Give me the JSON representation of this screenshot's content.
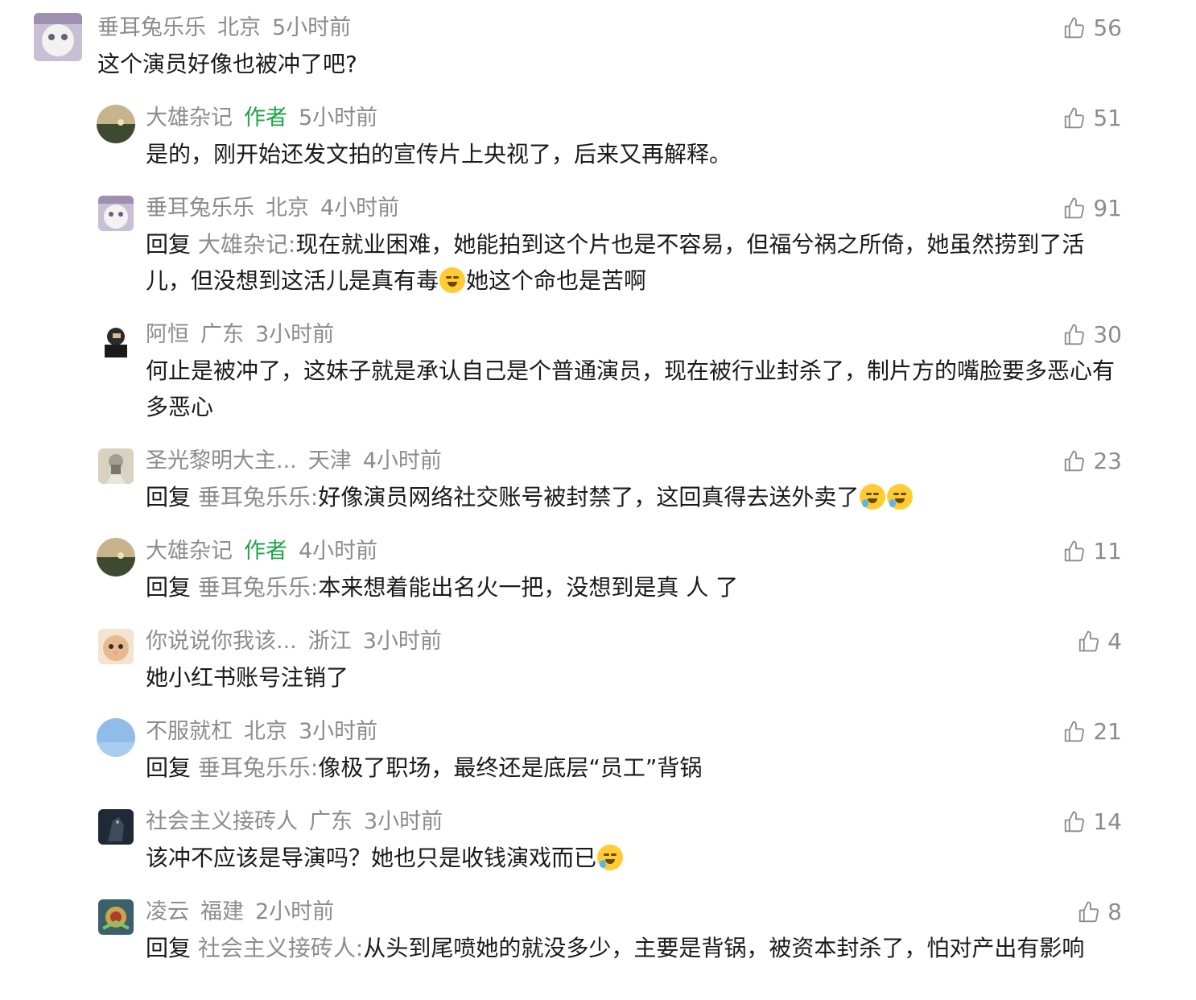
{
  "comments": [
    {
      "username": "垂耳兔乐乐",
      "author_tag": "",
      "location": "北京",
      "time": "5小时前",
      "likes": "56",
      "reply_label": "",
      "reply_to": "",
      "text": "这个演员好像也被冲了吧?",
      "emoji": [],
      "text_after": "",
      "avatar_color": "#b9a9c4"
    },
    {
      "username": "大雄杂记",
      "author_tag": "作者",
      "location": "",
      "time": "5小时前",
      "likes": "51",
      "reply_label": "",
      "reply_to": "",
      "text": "是的，刚开始还发文拍的宣传片上央视了，后来又再解释。",
      "emoji": [],
      "text_after": "",
      "avatar_color": "#7d7358"
    },
    {
      "username": "垂耳兔乐乐",
      "author_tag": "",
      "location": "北京",
      "time": "4小时前",
      "likes": "91",
      "reply_label": "回复",
      "reply_to": "大雄杂记:",
      "text": "现在就业困难，她能拍到这个片也是不容易，但福兮祸之所倚，她虽然捞到了活儿，但没想到这活儿是真有毒",
      "emoji": [
        "thinking"
      ],
      "text_after": "她这个命也是苦啊",
      "avatar_color": "#b9a9c4"
    },
    {
      "username": "阿恒",
      "author_tag": "",
      "location": "广东",
      "time": "3小时前",
      "likes": "30",
      "reply_label": "",
      "reply_to": "",
      "text": "何止是被冲了，这妹子就是承认自己是个普通演员，现在被行业封杀了，制片方的嘴脸要多恶心有多恶心",
      "emoji": [],
      "text_after": "",
      "avatar_color": "#2b2b2b"
    },
    {
      "username": "圣光黎明大主...",
      "author_tag": "",
      "location": "天津",
      "time": "4小时前",
      "likes": "23",
      "reply_label": "回复",
      "reply_to": "垂耳兔乐乐:",
      "text": "好像演员网络社交账号被封禁了，这回真得去送外卖了",
      "emoji": [
        "cry",
        "cry"
      ],
      "text_after": "",
      "avatar_color": "#a39d8f"
    },
    {
      "username": "大雄杂记",
      "author_tag": "作者",
      "location": "",
      "time": "4小时前",
      "likes": "11",
      "reply_label": "回复",
      "reply_to": "垂耳兔乐乐:",
      "text": "本来想着能出名火一把，没想到是真 人 了",
      "emoji": [],
      "text_after": "",
      "avatar_color": "#7d7358"
    },
    {
      "username": "你说说你我该...",
      "author_tag": "",
      "location": "浙江",
      "time": "3小时前",
      "likes": "4",
      "reply_label": "",
      "reply_to": "",
      "text": "她小红书账号注销了",
      "emoji": [],
      "text_after": "",
      "avatar_color": "#e7b98f"
    },
    {
      "username": "不服就杠",
      "author_tag": "",
      "location": "北京",
      "time": "3小时前",
      "likes": "21",
      "reply_label": "回复",
      "reply_to": "垂耳兔乐乐:",
      "text": "像极了职场，最终还是底层“员工”背锅",
      "emoji": [],
      "text_after": "",
      "avatar_color": "#7fb2e8"
    },
    {
      "username": "社会主义接砖人",
      "author_tag": "",
      "location": "广东",
      "time": "3小时前",
      "likes": "14",
      "reply_label": "",
      "reply_to": "",
      "text": "该冲不应该是导演吗？她也只是收钱演戏而已",
      "emoji": [
        "cry"
      ],
      "text_after": "",
      "avatar_color": "#1f2a36"
    },
    {
      "username": "凌云",
      "author_tag": "",
      "location": "福建",
      "time": "2小时前",
      "likes": "8",
      "reply_label": "回复",
      "reply_to": "社会主义接砖人:",
      "text": "从头到尾喷她的就没多少，主要是背锅，被资本封杀了，怕对产出有影响",
      "emoji": [],
      "text_after": "",
      "avatar_color": "#3b5f6b"
    }
  ]
}
